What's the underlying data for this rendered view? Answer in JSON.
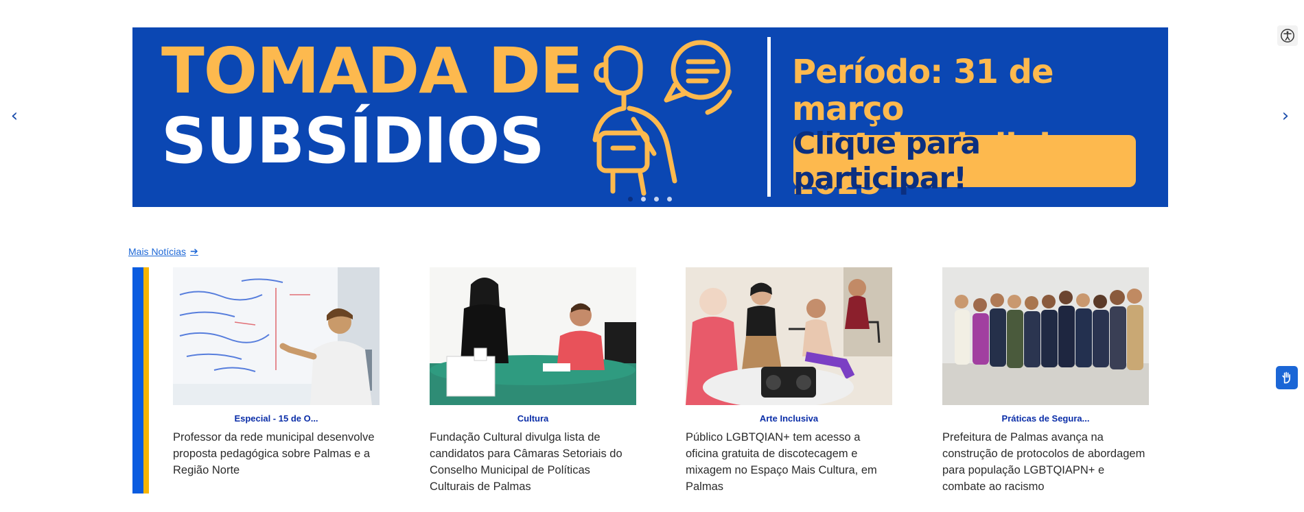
{
  "banner": {
    "title_line1": "TOMADA DE",
    "title_line2": "SUBSÍDIOS",
    "period_line1": "Período: 31 de março",
    "period_line2": "e 14 de abril de 2025",
    "cta": "Clique para participar!",
    "colors": {
      "background": "#0b47b3",
      "accent": "#fdb94e",
      "text": "#ffffff"
    }
  },
  "carousel": {
    "prev_icon": "chevron-left-icon",
    "next_icon": "chevron-right-icon",
    "prev_glyph": "‹",
    "next_glyph": "›",
    "slide_count": 4,
    "active_slide": 1
  },
  "news": {
    "more_link": "Mais Notícias",
    "more_icon": "arrow-right-icon",
    "items": [
      {
        "category": "Especial - 15 de O...",
        "headline": "Professor da rede municipal desenvolve proposta pedagógica sobre Palmas e a Região Norte"
      },
      {
        "category": "Cultura",
        "headline": "Fundação Cultural divulga lista de candidatos para Câmaras Setoriais do Conselho Municipal de Políticas Culturais de Palmas"
      },
      {
        "category": "Arte Inclusiva",
        "headline": "Público LGBTQIAN+ tem acesso a oficina gratuita de discotecagem e mixagem no Espaço Mais Cultura, em Palmas"
      },
      {
        "category": "Práticas de Segura...",
        "headline": "Prefeitura de Palmas avança na construção de protocolos de abordagem para população LGBTQIAPN+ e combate ao racismo"
      }
    ],
    "stripe_colors": {
      "blue": "#0b5ce0",
      "yellow": "#f8b500"
    }
  },
  "widgets": {
    "accessibility_icon": "accessibility-icon",
    "libras_icon": "sign-language-hand-icon"
  }
}
